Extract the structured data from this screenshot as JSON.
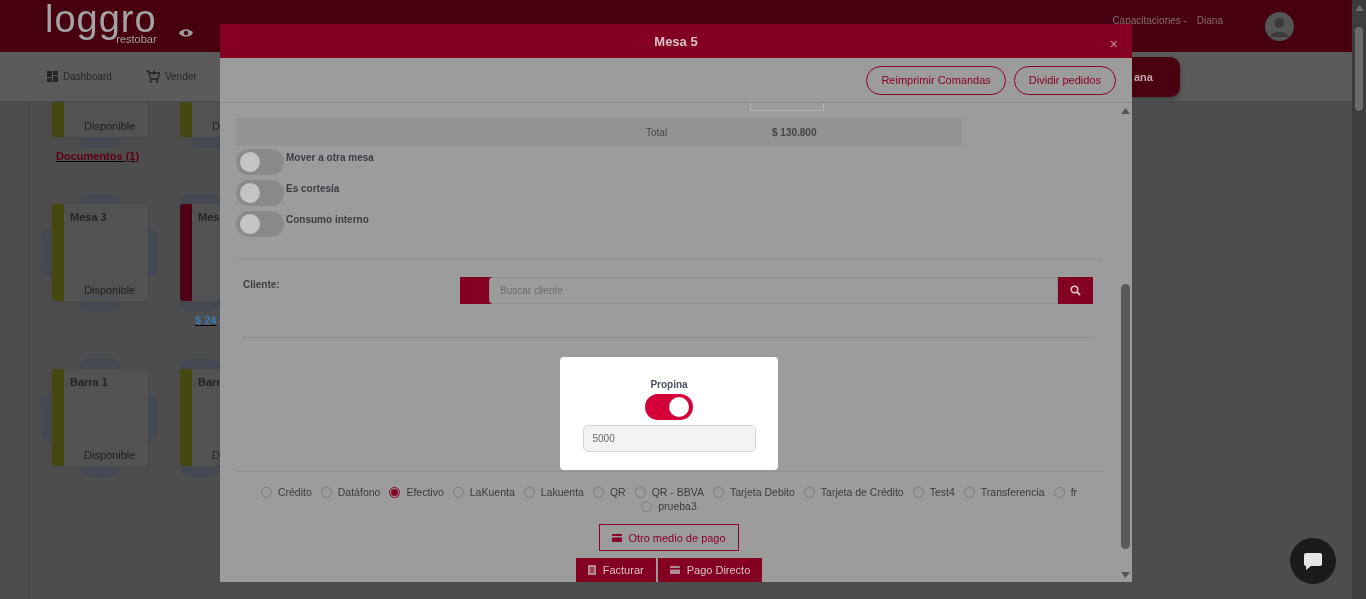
{
  "header": {
    "logo": "loggro",
    "logo_tagline": "restobar",
    "company": "Capacitaciones -",
    "user": "Diana"
  },
  "nav": {
    "items": [
      {
        "label": "Dashboard"
      },
      {
        "label": "Vender"
      }
    ],
    "cut_button": "ana"
  },
  "table_columns": [
    {
      "tables": [
        {
          "status": "Disponible",
          "color": "#45480f",
          "link": {
            "text": "Documentos (1)",
            "kind": "documents"
          }
        },
        {
          "name": "Mesa 3",
          "status": "Disponible",
          "color": "#45480f"
        },
        {
          "name": "Barra 1",
          "status": "Disponible",
          "color": "#45480f"
        }
      ]
    },
    {
      "tables": [
        {
          "status": "D",
          "color": "#45480f"
        },
        {
          "name": "Mes",
          "color": "#4f0015",
          "link": {
            "text": "$ 24",
            "kind": "amount"
          }
        },
        {
          "name": "Barr",
          "status": "D",
          "color": "#45480f"
        }
      ]
    }
  ],
  "modal": {
    "title": "Mesa 5",
    "close": "×",
    "actions": [
      "Reimprimir Comandas",
      "Dividir pedidos"
    ],
    "total_label": "Total",
    "total_value": "$ 130.800",
    "options": [
      {
        "label": "Mover a otra mesa",
        "on": false
      },
      {
        "label": "Es cortesía",
        "on": false
      },
      {
        "label": "Consumo interno",
        "on": false
      }
    ],
    "client": {
      "label": "Cliente:",
      "placeholder": "Buscar cliente"
    },
    "tip": {
      "title": "Propina",
      "on": true,
      "value": "5000"
    },
    "payment_methods": [
      {
        "label": "Crédito",
        "selected": false
      },
      {
        "label": "Datáfono",
        "selected": false
      },
      {
        "label": "Efectivo",
        "selected": true
      },
      {
        "label": "LaKuenta",
        "selected": false
      },
      {
        "label": "Lakuenta",
        "selected": false
      },
      {
        "label": "QR",
        "selected": false
      },
      {
        "label": "QR - BBVA",
        "selected": false
      },
      {
        "label": "Tarjeta Debito",
        "selected": false
      },
      {
        "label": "Tarjeta de Crédito",
        "selected": false
      },
      {
        "label": "Test4",
        "selected": false
      },
      {
        "label": "Transferencia",
        "selected": false
      },
      {
        "label": "fr",
        "selected": false
      },
      {
        "label": "prueba3",
        "selected": false
      }
    ],
    "other_payment": "Otro medio de pago",
    "footer_buttons": [
      {
        "label": "Facturar",
        "kind": "invoice"
      },
      {
        "label": "Pago Directo",
        "kind": "direct"
      }
    ]
  }
}
